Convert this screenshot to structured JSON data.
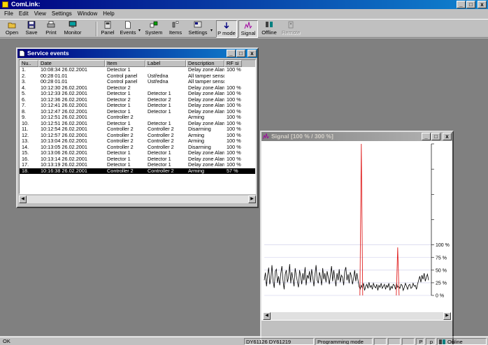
{
  "app": {
    "title": "ComLink:",
    "window_buttons": {
      "minimize": "_",
      "restore": "□",
      "close": "x"
    }
  },
  "menu": [
    "File",
    "Edit",
    "View",
    "Settings",
    "Window",
    "Help"
  ],
  "toolbar": {
    "open": "Open",
    "save": "Save",
    "print": "Print",
    "monitor": "Monitor",
    "panel": "Panel",
    "events": "Events",
    "system": "System",
    "items": "Items",
    "settings": "Settings",
    "pmode": "P mode",
    "signal": "Signal",
    "offline": "Offline",
    "remote": "Remote",
    "dropdown_arrow": "▾"
  },
  "service_events": {
    "title": "Service events",
    "columns": [
      "Nu..",
      "Date",
      "Item",
      "Label",
      "Description",
      "RF si"
    ],
    "rows": [
      [
        "1.",
        "10:08:34 26.02.2001",
        "Detector 1",
        "",
        "Delay zone Alarm",
        "100 %"
      ],
      [
        "2.",
        "00:28 01.01",
        "Control panel",
        "Ústředna",
        "All tamper senso...",
        ""
      ],
      [
        "3.",
        "00:28 01.01",
        "Control panel",
        "Ústředna",
        "All tamper senso...",
        ""
      ],
      [
        "4.",
        "10:12:30 26.02.2001",
        "Detector 2",
        "",
        "Delay zone Alarm",
        "100 %"
      ],
      [
        "5.",
        "10:12:33 26.02.2001",
        "Detector 1",
        "Detector 1",
        "Delay zone Alarm",
        "100 %"
      ],
      [
        "6.",
        "10:12:36 26.02.2001",
        "Detector 2",
        "Detector 2",
        "Delay zone Alarm",
        "100 %"
      ],
      [
        "7.",
        "10:12:41 26.02.2001",
        "Detector 1",
        "Detector 1",
        "Delay zone Alarm",
        "100 %"
      ],
      [
        "8.",
        "10:12:47 26.02.2001",
        "Detector 1",
        "Detector 1",
        "Delay zone Alarm",
        "100 %"
      ],
      [
        "9.",
        "10:12:51 26.02.2001",
        "Controller 2",
        "",
        "Arming",
        "100 %"
      ],
      [
        "10.",
        "10:12:51 26.02.2001",
        "Detector 1",
        "Detector 1",
        "Delay zone Alarm",
        "100 %"
      ],
      [
        "11.",
        "10:12:54 26.02.2001",
        "Controller 2",
        "Controller 2",
        "Disarming",
        "100 %"
      ],
      [
        "12.",
        "10:12:57 26.02.2001",
        "Controller 2",
        "Controller 2",
        "Arming",
        "100 %"
      ],
      [
        "13.",
        "10:13:04 26.02.2001",
        "Controller 2",
        "Controller 2",
        "Arming",
        "100 %"
      ],
      [
        "14.",
        "10:13:05 26.02.2001",
        "Controller 2",
        "Controller 2",
        "Disarming",
        "100 %"
      ],
      [
        "15.",
        "10:13:06 26.02.2001",
        "Detector 1",
        "Detector 1",
        "Delay zone Alarm",
        "100 %"
      ],
      [
        "16.",
        "10:13:14 26.02.2001",
        "Detector 1",
        "Detector 1",
        "Delay zone Alarm",
        "100 %"
      ],
      [
        "17.",
        "10:13:19 26.02.2001",
        "Detector 1",
        "Detector 1",
        "Delay zone Alarm",
        "100 %"
      ],
      [
        "18.",
        "10:16:38 26.02.2001",
        "Controller 2",
        "Controller 2",
        "Arming",
        "57 %"
      ]
    ],
    "selected_row": 17
  },
  "signal": {
    "title": "Signal [100 % / 300 %]",
    "scale_labels": [
      "100 %",
      "75 %",
      "50 %",
      "25 %",
      "0 %"
    ],
    "chart_data": {
      "type": "line",
      "title": "",
      "xlabel": "",
      "ylabel": "",
      "ylim": [
        0,
        300
      ],
      "series": [
        {
          "values": [
            30,
            45,
            18,
            40,
            55,
            22,
            35,
            60,
            28,
            15,
            48,
            52,
            25,
            38,
            20,
            44,
            58,
            30,
            12,
            42,
            50,
            26,
            36,
            62,
            24,
            46,
            33,
            18,
            54,
            40,
            28,
            16,
            50,
            38,
            22,
            44,
            30,
            56,
            20,
            40,
            34,
            48,
            26,
            52,
            36,
            18,
            42,
            60,
            30,
            24,
            46,
            38,
            20,
            54,
            32,
            44,
            26,
            48,
            36,
            22,
            40,
            58,
            28,
            50,
            34,
            18,
            44,
            30,
            52,
            26,
            40,
            36,
            20,
            48,
            56,
            30,
            42,
            24,
            46,
            38,
            22,
            34,
            50,
            28,
            44,
            30,
            18,
            12,
            20,
            15,
            24,
            10,
            18,
            22,
            14,
            26,
            16,
            20,
            12,
            24,
            18,
            15,
            22,
            10,
            20,
            16,
            24,
            14,
            18,
            22,
            12,
            20,
            16,
            24,
            10,
            18,
            14,
            22,
            20,
            12,
            24,
            16,
            18,
            14,
            22,
            20,
            10,
            16,
            24,
            18,
            12,
            20,
            22,
            14,
            16,
            24,
            18,
            20,
            12,
            22,
            30,
            38,
            26,
            40,
            32,
            44,
            28,
            36,
            42,
            30
          ]
        },
        {
          "values": [
            0,
            0,
            0,
            0,
            0,
            0,
            0,
            0,
            0,
            0,
            0,
            0,
            0,
            0,
            0,
            0,
            0,
            0,
            0,
            0,
            0,
            0,
            0,
            0,
            0,
            0,
            0,
            0,
            0,
            0,
            0,
            0,
            0,
            0,
            0,
            0,
            0,
            0,
            0,
            0,
            0,
            0,
            0,
            0,
            0,
            0,
            0,
            0,
            0,
            0,
            0,
            0,
            0,
            0,
            0,
            0,
            0,
            0,
            0,
            0,
            0,
            0,
            0,
            0,
            0,
            0,
            0,
            0,
            0,
            0,
            0,
            0,
            0,
            0,
            0,
            0,
            0,
            0,
            0,
            0,
            0,
            0,
            0,
            0,
            0,
            0,
            0,
            0,
            0,
            0,
            0,
            0,
            0,
            0,
            0,
            0,
            0,
            0,
            0,
            0,
            0,
            0,
            0,
            0,
            0,
            0,
            0,
            0,
            0,
            0,
            0,
            0,
            0,
            0,
            0,
            0,
            0,
            0,
            0,
            0,
            0,
            0,
            0,
            0,
            0,
            0,
            0,
            0,
            0,
            0,
            0,
            0,
            0,
            0,
            0,
            0,
            0,
            0,
            0,
            0,
            0,
            0,
            0,
            0,
            0,
            0,
            0,
            0,
            0,
            0
          ],
          "spikes": [
            {
              "index": 88,
              "value": 300
            },
            {
              "index": 121,
              "value": 95
            }
          ]
        }
      ]
    }
  },
  "status": {
    "ok": "OK",
    "ids": "DY61126  DY61219",
    "mode": "Programming mode",
    "p_upper": "P",
    "p_lower": "p",
    "online": "Online"
  }
}
